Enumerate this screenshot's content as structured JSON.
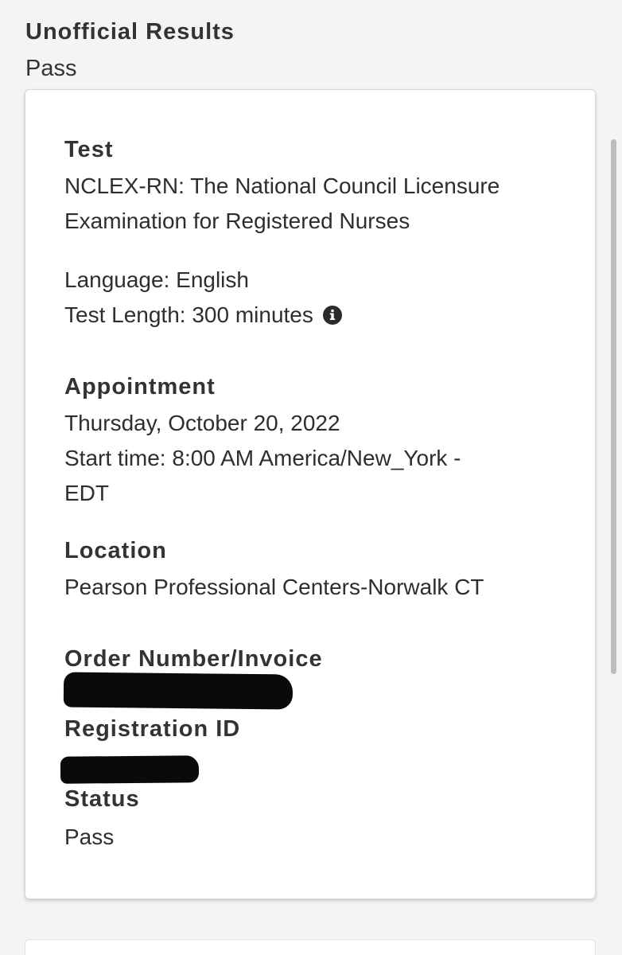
{
  "header": {
    "title": "Unofficial Results",
    "result": "Pass"
  },
  "test": {
    "label": "Test",
    "name_line1": "NCLEX-RN: The National Council Licensure",
    "name_line2": "Examination for Registered Nurses",
    "language": "Language:  English",
    "length": "Test Length: 300 minutes",
    "info_icon": "info-circle-icon"
  },
  "appointment": {
    "label": "Appointment",
    "date": "Thursday, October 20, 2022",
    "start_line1": "Start time: 8:00 AM America/New_York -",
    "start_line2": "EDT"
  },
  "location": {
    "label": "Location",
    "value": "Pearson Professional Centers-Norwalk CT"
  },
  "order": {
    "label": "Order Number/Invoice"
  },
  "registration": {
    "label": "Registration ID"
  },
  "status": {
    "label": "Status",
    "value": "Pass"
  }
}
